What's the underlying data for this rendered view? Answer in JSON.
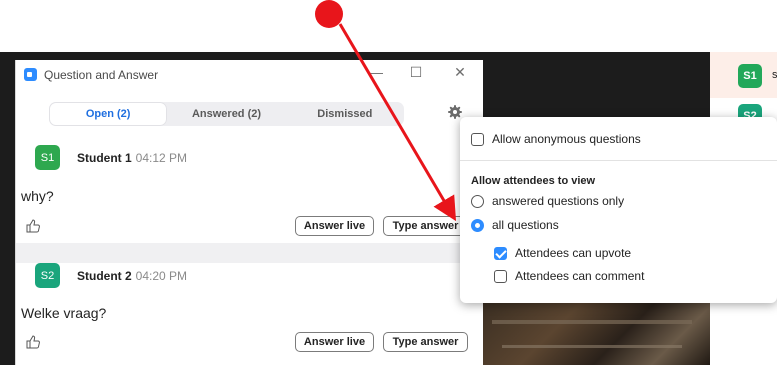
{
  "window": {
    "title": "Question and Answer",
    "minimize": "—",
    "maximize": "☐",
    "close": "✕"
  },
  "tabs": [
    {
      "label": "Open (2)",
      "active": true
    },
    {
      "label": "Answered (2)",
      "active": false
    },
    {
      "label": "Dismissed",
      "active": false
    }
  ],
  "questions": [
    {
      "initials": "S1",
      "avatar_color": "#2ea84f",
      "name": "Student 1",
      "time": "04:12 PM",
      "text": "why?",
      "answer_live_label": "Answer live",
      "type_answer_label": "Type answer"
    },
    {
      "initials": "S2",
      "avatar_color": "#1aa57c",
      "name": "Student 2",
      "time": "04:20 PM",
      "text": "Welke vraag?",
      "answer_live_label": "Answer live",
      "type_answer_label": "Type answer"
    }
  ],
  "settings_popup": {
    "allow_anonymous": {
      "label": "Allow anonymous questions",
      "checked": false
    },
    "view_heading": "Allow attendees to view",
    "options": [
      {
        "label": "answered questions only",
        "selected": false
      },
      {
        "label": "all questions",
        "selected": true
      }
    ],
    "attendees_can_upvote": {
      "label": "Attendees can upvote",
      "checked": true
    },
    "attendees_can_comment": {
      "label": "Attendees can comment",
      "checked": false
    }
  },
  "participants": [
    {
      "initials": "S1",
      "label": "s"
    },
    {
      "initials": "S2"
    }
  ],
  "colors": {
    "accent": "#2d8cff",
    "annotation": "#e8151b",
    "avatar_green": "#22a85a"
  }
}
